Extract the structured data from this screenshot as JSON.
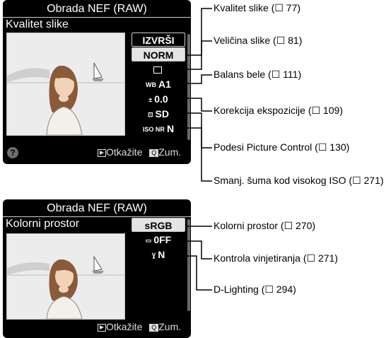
{
  "screen1": {
    "title": "Obrada NEF (RAW)",
    "subtitle": "Kvalitet slike",
    "items": [
      {
        "label": "IZVRŠI",
        "icon": ""
      },
      {
        "label": "NORM",
        "icon": ""
      },
      {
        "label": "",
        "icon": "image-size-icon"
      },
      {
        "label": "A1",
        "icon": "wb-icon",
        "icon_text": "WB"
      },
      {
        "label": "0.0",
        "icon": "exposure-comp-icon",
        "icon_text": "±"
      },
      {
        "label": "SD",
        "icon": "picture-control-icon",
        "icon_text": "⊡"
      },
      {
        "label": "N",
        "icon": "iso-nr-icon",
        "icon_text": "ISO NR"
      }
    ],
    "help_label": "?",
    "cancel_label": "Otkažite",
    "zoom_label": "Zum."
  },
  "screen2": {
    "title": "Obrada NEF (RAW)",
    "subtitle": "Kolorni prostor",
    "items": [
      {
        "label": "sRGB",
        "icon": ""
      },
      {
        "label": "0FF",
        "icon": "vignette-icon",
        "icon_text": "▭"
      },
      {
        "label": "N",
        "icon": "d-lighting-icon",
        "icon_text": "Ɣ"
      }
    ],
    "cancel_label": "Otkažite",
    "zoom_label": "Zum."
  },
  "annotations1": [
    "Kvalitet slike (☐ 77)",
    "Veličina slike (☐ 81)",
    "Balans bele (☐ 111)",
    "Korekcija ekspozicije (☐ 109)",
    "Podesi Picture Control (☐ 130)",
    "Smanj. šuma kod visokog ISO (☐ 271)"
  ],
  "annotations2": [
    "Kolorni prostor (☐ 270)",
    "Kontrola vinjetiranja (☐ 271)",
    "D-Lighting (☐ 294)"
  ],
  "colors": {
    "screen_bg": "#000000",
    "button_light": "#e4e4e4",
    "text": "#ffffff",
    "leader_line": "#000000"
  }
}
